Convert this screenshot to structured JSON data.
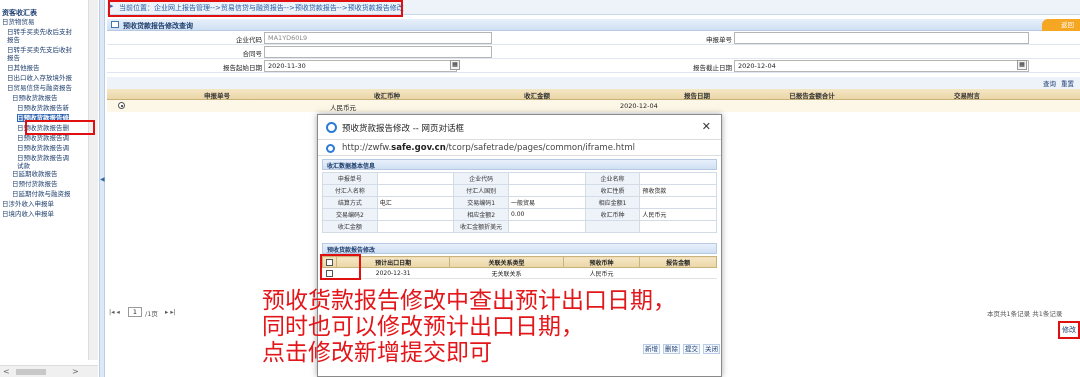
{
  "sidebar": {
    "title": "资客收汇表",
    "items": [
      {
        "label": "日货物贸易",
        "indent": 0
      },
      {
        "label": "日转手买卖先收后支封",
        "indent": 1
      },
      {
        "label": "报告",
        "indent": 1
      },
      {
        "label": "日转手买卖先支后收封",
        "indent": 1
      },
      {
        "label": "报告",
        "indent": 1
      },
      {
        "label": "日其他报告",
        "indent": 1
      },
      {
        "label": "日出口收入存放境外报",
        "indent": 1
      },
      {
        "label": "日贸易信贷与融资报告",
        "indent": 1
      },
      {
        "label": "日预收货款报告",
        "indent": 2
      },
      {
        "label": "日预收货款报告新",
        "indent": 3
      },
      {
        "label": "日预收货款报告修",
        "indent": 3,
        "selected": true
      },
      {
        "label": "日预收货款报告删",
        "indent": 3
      },
      {
        "label": "日预收货款报告调",
        "indent": 3
      },
      {
        "label": "日预收货款报告调",
        "indent": 3
      },
      {
        "label": "日预收货款报告调",
        "indent": 3
      },
      {
        "label": "试款",
        "indent": 3
      },
      {
        "label": "日延期收款报告",
        "indent": 2
      },
      {
        "label": "日预付货款报告",
        "indent": 2
      },
      {
        "label": "日延期付款与融资报",
        "indent": 2
      },
      {
        "label": "日涉外收入申报单",
        "indent": 0
      },
      {
        "label": "日境内收入申报单",
        "indent": 0
      }
    ]
  },
  "breadcrumb": "当前位置：企业网上报告管理-->贸易信贷与融资报告-->预收贷款报告-->预收货款报告修改",
  "panel": {
    "title": "预收贷款报告修改查询",
    "tab_right": "返回"
  },
  "form": {
    "company_code_label": "企业代码",
    "company_code_value": "MA1YD60L9",
    "report_no_label": "申报单号",
    "contract_label": "合同号",
    "start_date_label": "报告起始日期",
    "start_date_value": "2020-11-30",
    "end_date_label": "报告截止日期",
    "end_date_value": "2020-12-04"
  },
  "buttons": {
    "query": "查询",
    "reset": "重置"
  },
  "grid": {
    "headers": [
      "申报单号",
      "收汇币种",
      "收汇金额",
      "报告日期",
      "已报告金额合计",
      "交易附言"
    ],
    "row": {
      "currency": "人民币元",
      "date": "2020-12-04"
    }
  },
  "pager": {
    "page": "1",
    "total_pages": "/1页",
    "summary": "本页共1条记录 共1条记录",
    "modify": "修改"
  },
  "dialog": {
    "title": "预收货款报告修改 -- 网页对话框",
    "url_prefix": "http://zwfw.",
    "url_domain": "safe.gov.cn",
    "url_suffix": "/tcorp/safetrade/pages/common/iframe.html",
    "section1": "收汇数据基本信息",
    "info": [
      [
        "申报单号",
        "",
        "企业代码",
        "",
        "企业名称",
        ""
      ],
      [
        "付汇人名称",
        "",
        "付汇人国别",
        "",
        "收汇性质",
        "预收货款"
      ],
      [
        "结算方式",
        "电汇",
        "交易编码1",
        "一般贸易",
        "相应金额1",
        ""
      ],
      [
        "交易编码2",
        "",
        "相应金额2",
        "0.00",
        "收汇币种",
        "人民币元"
      ],
      [
        "收汇金额",
        "",
        "收汇金额折美元",
        "",
        "",
        ""
      ]
    ],
    "section2": "预收货款报告修改",
    "sub_headers": [
      "预计出口日期",
      "关联关系类型",
      "预收币种",
      "报告金额"
    ],
    "sub_row": {
      "date": "2020-12-31",
      "relation": "无关联关系",
      "currency": "人民币元",
      "amount": ""
    },
    "buttons": [
      "新增",
      "删除",
      "提交",
      "关闭"
    ]
  },
  "annotation": [
    "预收货款报告修改中查出预计出口日期，",
    "同时也可以修改预计出口日期，",
    "点击修改新增提交即可"
  ]
}
